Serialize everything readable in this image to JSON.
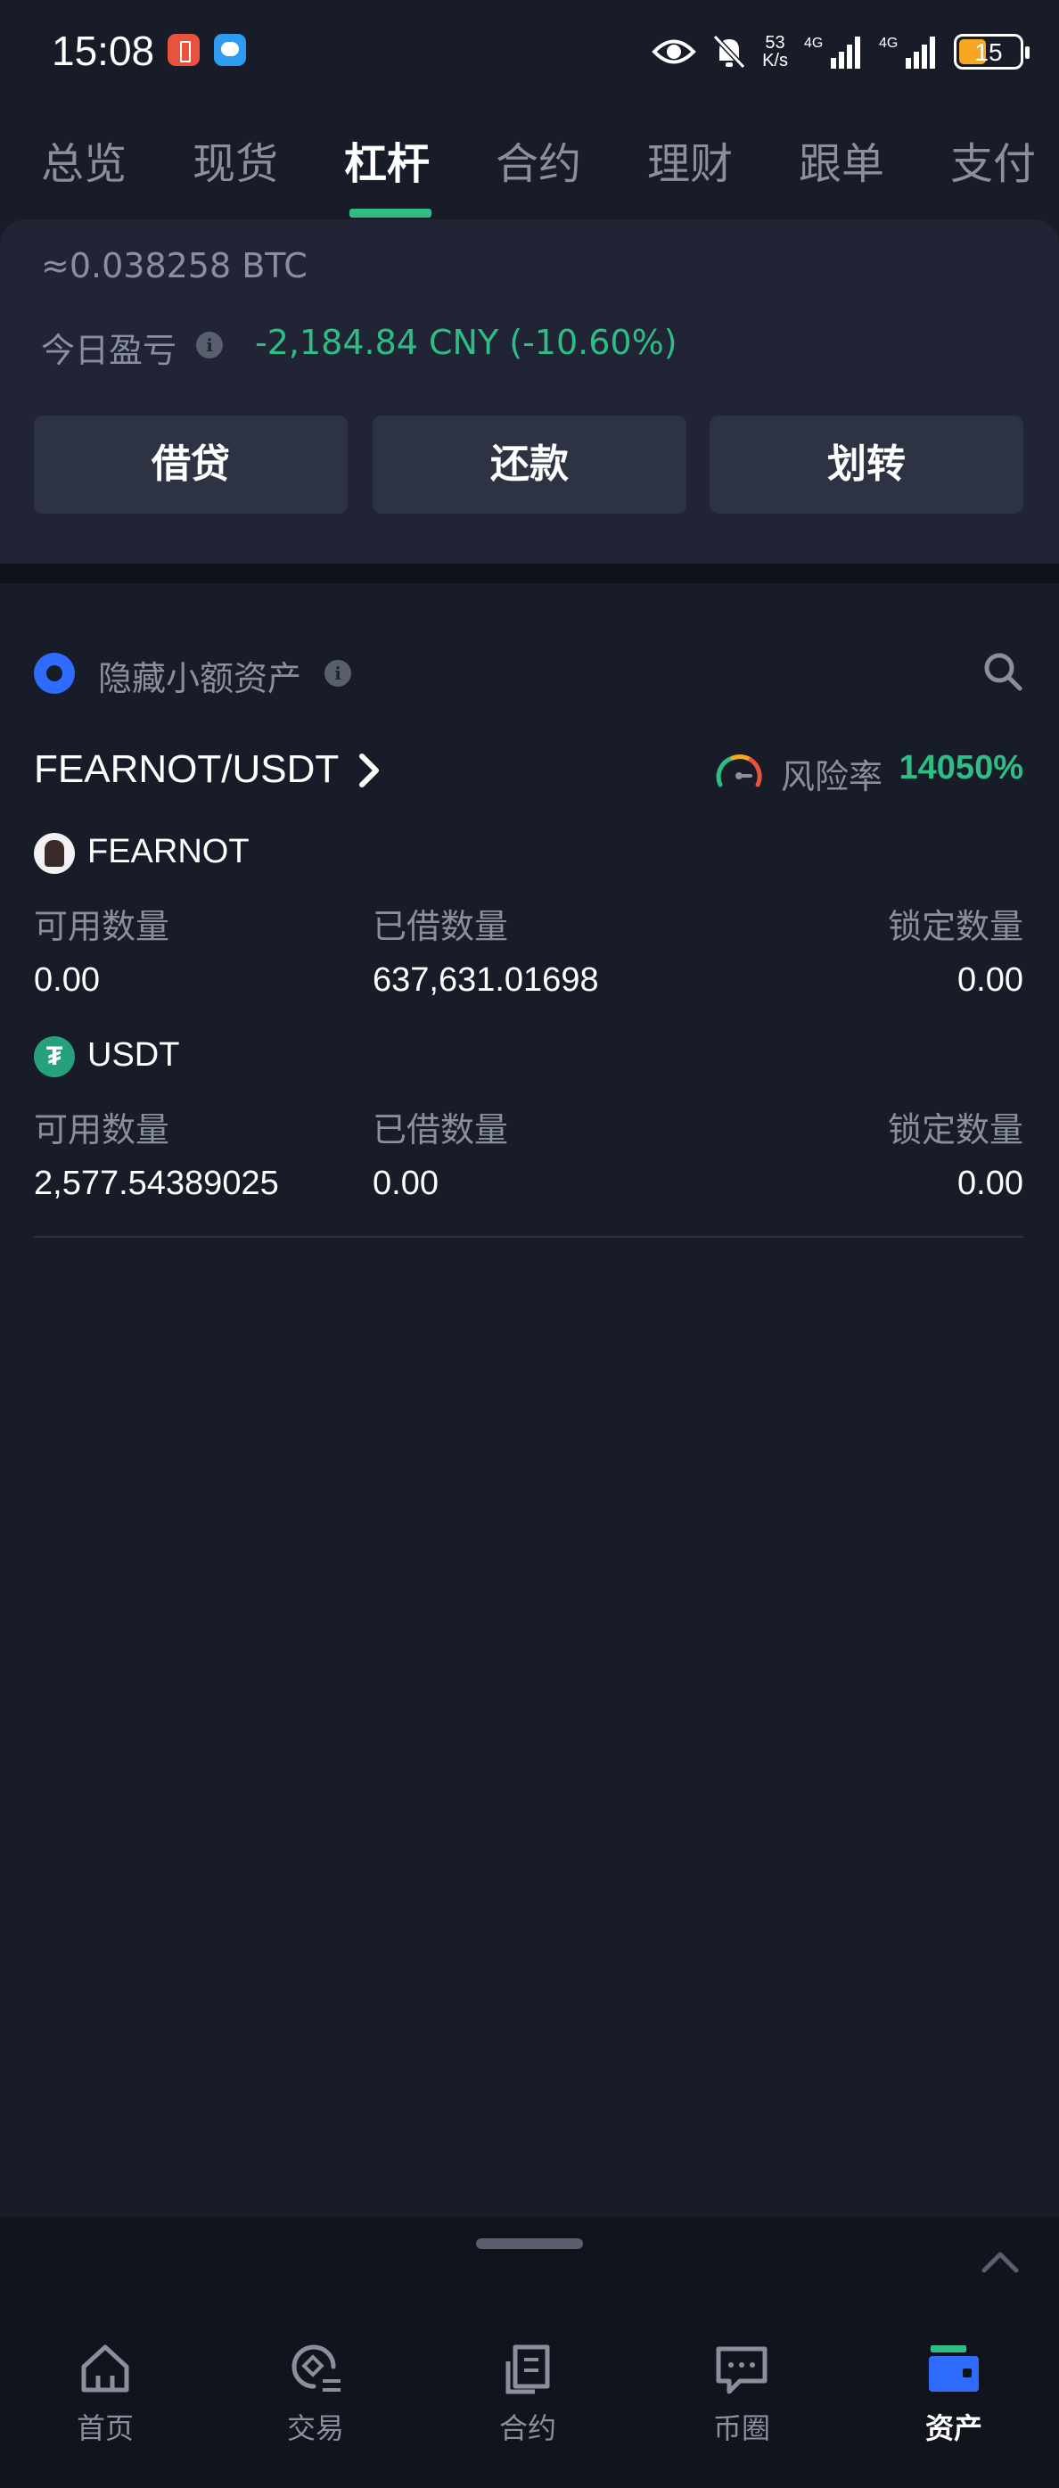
{
  "status_bar": {
    "time": "15:08",
    "speed_top": "53",
    "speed_bottom": "K/s",
    "network1": "4G",
    "network2": "4G",
    "battery": "15",
    "battery_level": 0.15
  },
  "tabs": [
    {
      "label": "总览",
      "active": false
    },
    {
      "label": "现货",
      "active": false
    },
    {
      "label": "杠杆",
      "active": true
    },
    {
      "label": "合约",
      "active": false
    },
    {
      "label": "理财",
      "active": false
    },
    {
      "label": "跟单",
      "active": false
    },
    {
      "label": "支付",
      "active": false
    }
  ],
  "summary": {
    "btc_amount": "≈0.038258 BTC",
    "pnl_label": "今日盈亏",
    "pnl_value": "-2,184.84 CNY (-10.60%)"
  },
  "actions": {
    "borrow": "借贷",
    "repay": "还款",
    "transfer": "划转"
  },
  "filter": {
    "hide_small_label": "隐藏小额资产"
  },
  "pair": {
    "name": "FEARNOT/USDT",
    "risk_label": "风险率",
    "risk_value": "14050%"
  },
  "coins": [
    {
      "name": "FEARNOT",
      "available_label": "可用数量",
      "borrowed_label": "已借数量",
      "locked_label": "锁定数量",
      "available": "0.00",
      "borrowed": "637,631.01698",
      "locked": "0.00"
    },
    {
      "name": "USDT",
      "available_label": "可用数量",
      "borrowed_label": "已借数量",
      "locked_label": "锁定数量",
      "available": "2,577.54389025",
      "borrowed": "0.00",
      "locked": "0.00"
    }
  ],
  "usdt_symbol": "₮",
  "bottom_nav": [
    {
      "label": "首页",
      "icon": "home-icon",
      "active": false
    },
    {
      "label": "交易",
      "icon": "trade-icon",
      "active": false
    },
    {
      "label": "合约",
      "icon": "contract-icon",
      "active": false
    },
    {
      "label": "币圈",
      "icon": "chat-icon",
      "active": false
    },
    {
      "label": "资产",
      "icon": "wallet-icon",
      "active": true
    }
  ],
  "colors": {
    "background": "#181b28",
    "accent_green": "#2ebd85",
    "accent_blue": "#2f6bff",
    "muted_text": "#8a8f9e"
  }
}
